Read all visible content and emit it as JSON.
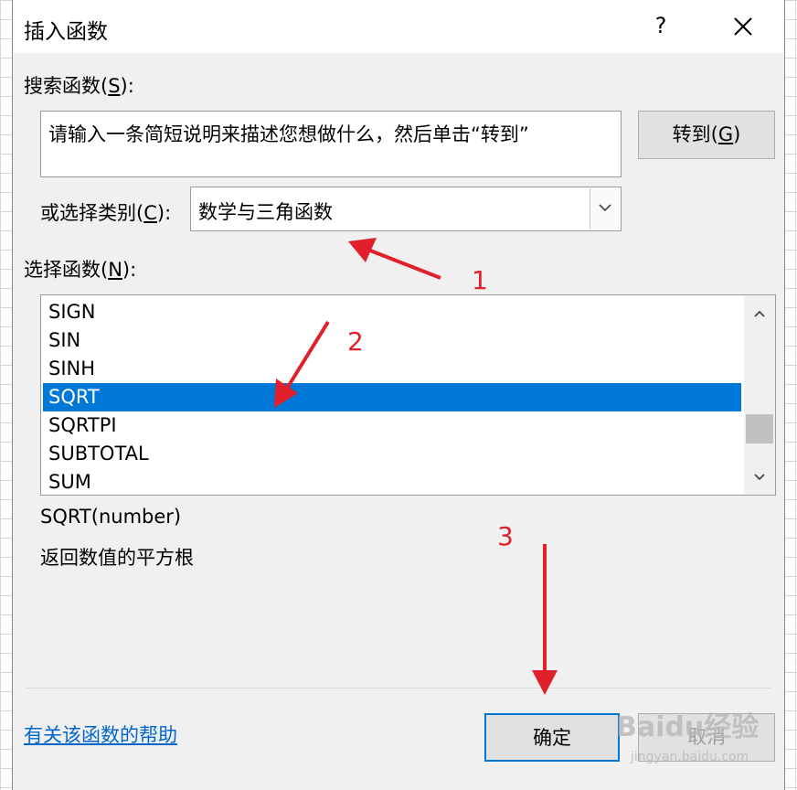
{
  "dialog": {
    "title": "插入函数",
    "help_glyph": "?",
    "search_label_prefix": "搜索函数(",
    "search_label_key": "S",
    "search_label_suffix": "):",
    "search_text": "请输入一条简短说明来描述您想做什么，然后单击“转到”",
    "goto_prefix": "转到(",
    "goto_key": "G",
    "goto_suffix": ")",
    "category_label_prefix": "或选择类别(",
    "category_label_key": "C",
    "category_label_suffix": "):",
    "category_value": "数学与三角函数",
    "function_label_prefix": "选择函数(",
    "function_label_key": "N",
    "function_label_suffix": "):",
    "functions": [
      "SIGN",
      "SIN",
      "SINH",
      "SQRT",
      "SQRTPI",
      "SUBTOTAL",
      "SUM"
    ],
    "selected_function": "SQRT",
    "syntax": "SQRT(number)",
    "description": "返回数值的平方根",
    "help_link": "有关该函数的帮助",
    "ok_label": "确定",
    "cancel_label": "取消"
  },
  "annotations": {
    "step1": "1",
    "step2": "2",
    "step3": "3",
    "color": "#e0202a"
  },
  "watermark": {
    "brand": "Baidu经验",
    "url": "jingyan.baidu.com"
  },
  "colors": {
    "selection": "#0078d7",
    "link": "#0066cc",
    "dialog_bg": "#f0f0f0"
  }
}
